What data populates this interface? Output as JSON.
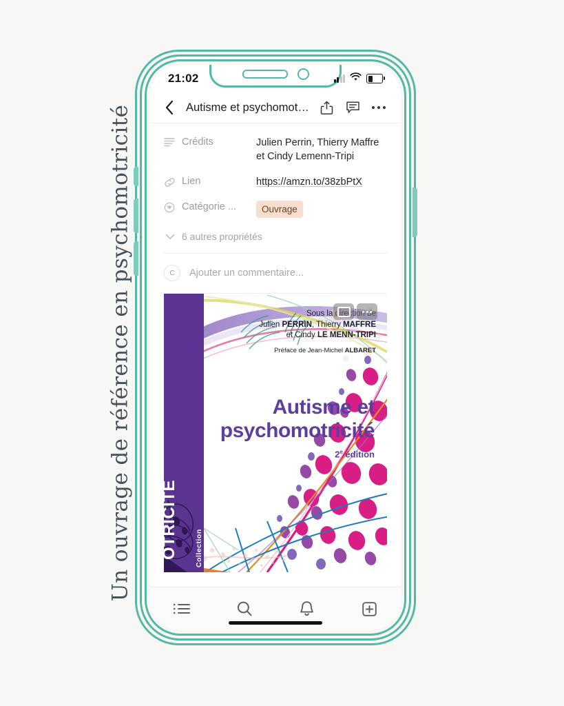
{
  "side_caption": "Un ouvrage de référence en psychomotricité",
  "status_bar": {
    "time": "21:02",
    "signal_icon": "cellular-signal-icon",
    "wifi_icon": "wifi-icon",
    "battery_icon": "battery-low-icon"
  },
  "nav_bar": {
    "back_icon": "chevron-left-icon",
    "title": "Autisme et psychomotricité",
    "share_icon": "share-icon",
    "comment_icon": "comment-icon",
    "more_icon": "more-horizontal-icon"
  },
  "properties": [
    {
      "icon": "text-lines-icon",
      "label": "Crédits",
      "value": "Julien Perrin, Thierry Maffre et Cindy Lemenn-Tripi",
      "type": "text"
    },
    {
      "icon": "link-icon",
      "label": "Lien",
      "value": "https://amzn.to/38zbPtX",
      "type": "link"
    },
    {
      "icon": "select-circle-icon",
      "label": "Catégorie ...",
      "value": "Ouvrage",
      "type": "tag"
    }
  ],
  "more_properties": {
    "icon": "chevron-down-icon",
    "label": "6 autres propriétés"
  },
  "comment": {
    "avatar_initial": "C",
    "placeholder": "Ajouter un commentaire..."
  },
  "cover": {
    "overlay_buttons": [
      {
        "icon": "expand-screen-icon"
      },
      {
        "icon": "more-horizontal-icon"
      }
    ],
    "direction_line": "Sous la direction de",
    "authors_line_1_plain": "Julien ",
    "authors_line_1_bold": "PERRIN",
    "authors_line_1_mid": ", Thierry ",
    "authors_line_1_bold2": "MAFFRE",
    "authors_line_2_plain": "et Cindy ",
    "authors_line_2_bold": "LE MENN-TRIPI",
    "preface_plain": "Préface de Jean-Michel ",
    "preface_bold": "ALBARET",
    "title_line_1": "Autisme et",
    "title_line_2": "psychomotricité",
    "edition": "2e édition",
    "edition_sup": "e",
    "spine_collection": "Collection",
    "spine_title": "OTRICITÉ",
    "colors": {
      "spine_purple": "#5b3391",
      "title_purple": "#5b3e9e",
      "magenta": "#d81e84",
      "blue": "#1b7bbd",
      "orange": "#e08a28"
    }
  },
  "tab_bar": [
    {
      "icon": "list-icon",
      "name": "tab-list"
    },
    {
      "icon": "search-icon",
      "name": "tab-search"
    },
    {
      "icon": "bell-icon",
      "name": "tab-notifications"
    },
    {
      "icon": "plus-square-icon",
      "name": "tab-add"
    }
  ],
  "theme": {
    "page_background": "#f7f7f6",
    "frame_teal": "#54b8a6",
    "tag_background": "#f9dfcf",
    "tag_text": "#6a4228"
  }
}
